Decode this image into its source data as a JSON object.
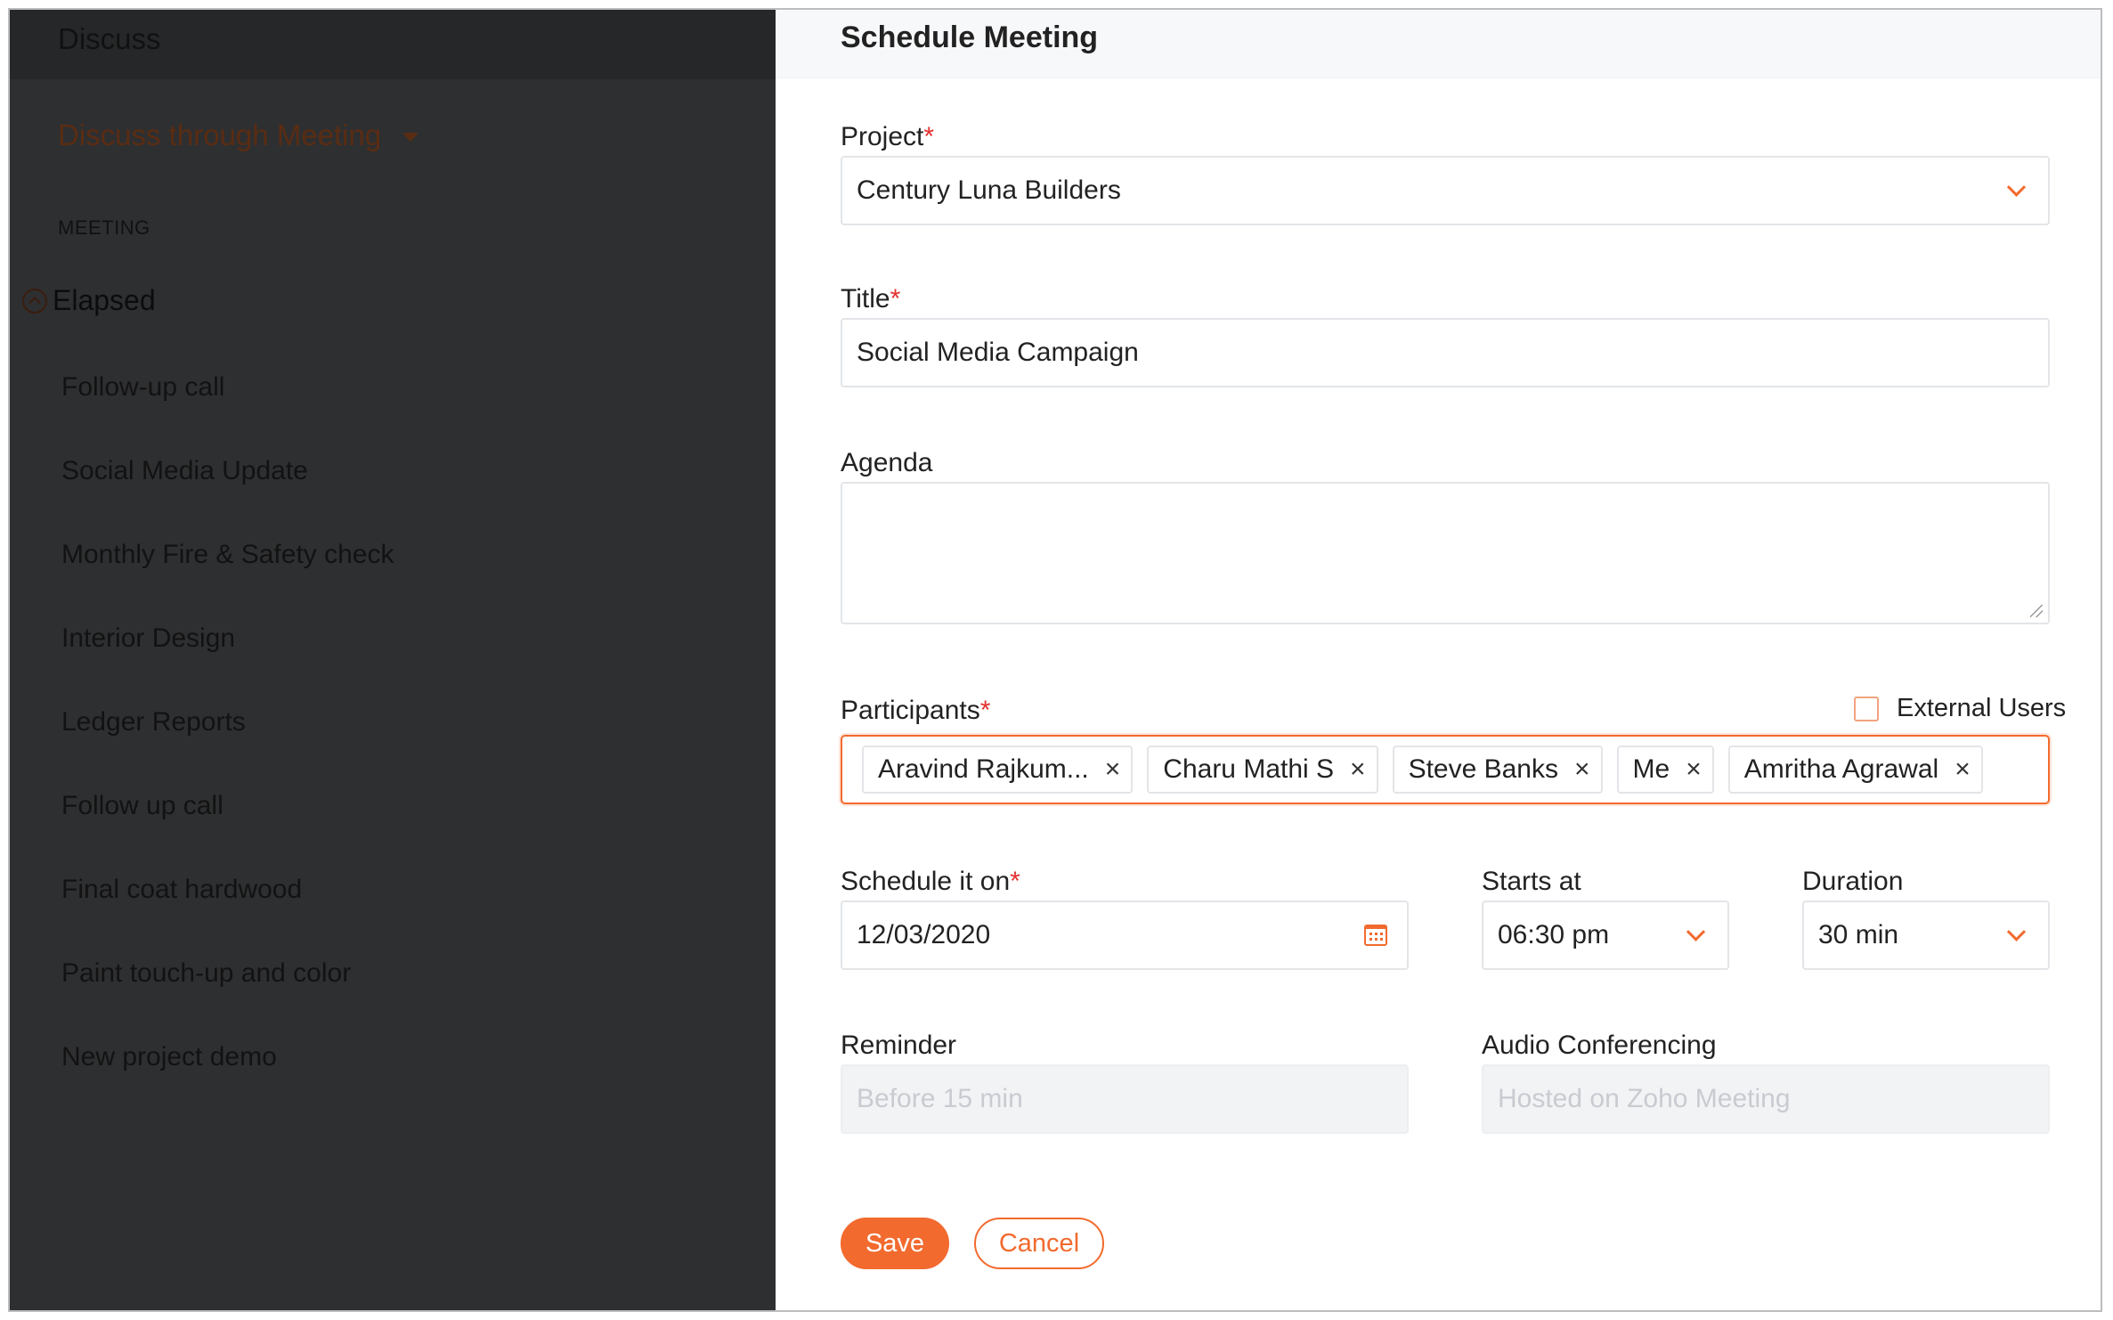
{
  "sidebar": {
    "header": "Discuss",
    "title": "Discuss through Meeting",
    "section": "MEETING",
    "group": "Elapsed",
    "items": [
      "Follow-up call",
      "Social Media Update",
      "Monthly Fire & Safety check",
      "Interior Design",
      "Ledger Reports",
      "Follow up call",
      "Final coat hardwood",
      "Paint touch-up and color",
      "New project demo"
    ]
  },
  "modal": {
    "title": "Schedule Meeting",
    "project": {
      "label": "Project",
      "required": "*",
      "value": "Century Luna Builders"
    },
    "meeting_title": {
      "label": "Title",
      "required": "*",
      "value": "Social Media Campaign"
    },
    "agenda": {
      "label": "Agenda",
      "value": ""
    },
    "participants": {
      "label": "Participants",
      "required": "*",
      "external_users_label": "External Users",
      "external_users_checked": false,
      "chips": [
        "Aravind Rajkum...",
        "Charu Mathi S",
        "Steve Banks",
        "Me",
        "Amritha Agrawal"
      ],
      "remove_glyph": "×"
    },
    "schedule_on": {
      "label": "Schedule it on",
      "required": "*",
      "value": "12/03/2020"
    },
    "starts_at": {
      "label": "Starts at",
      "value": "06:30 pm"
    },
    "duration": {
      "label": "Duration",
      "value": "30 min"
    },
    "reminder": {
      "label": "Reminder",
      "placeholder": "Before 15 min"
    },
    "audio": {
      "label": "Audio Conferencing",
      "placeholder": "Hosted on Zoho Meeting"
    },
    "save_label": "Save",
    "cancel_label": "Cancel"
  },
  "colors": {
    "accent": "#f26a2e",
    "required": "#e3302f",
    "overlay": "#2e2f31"
  }
}
